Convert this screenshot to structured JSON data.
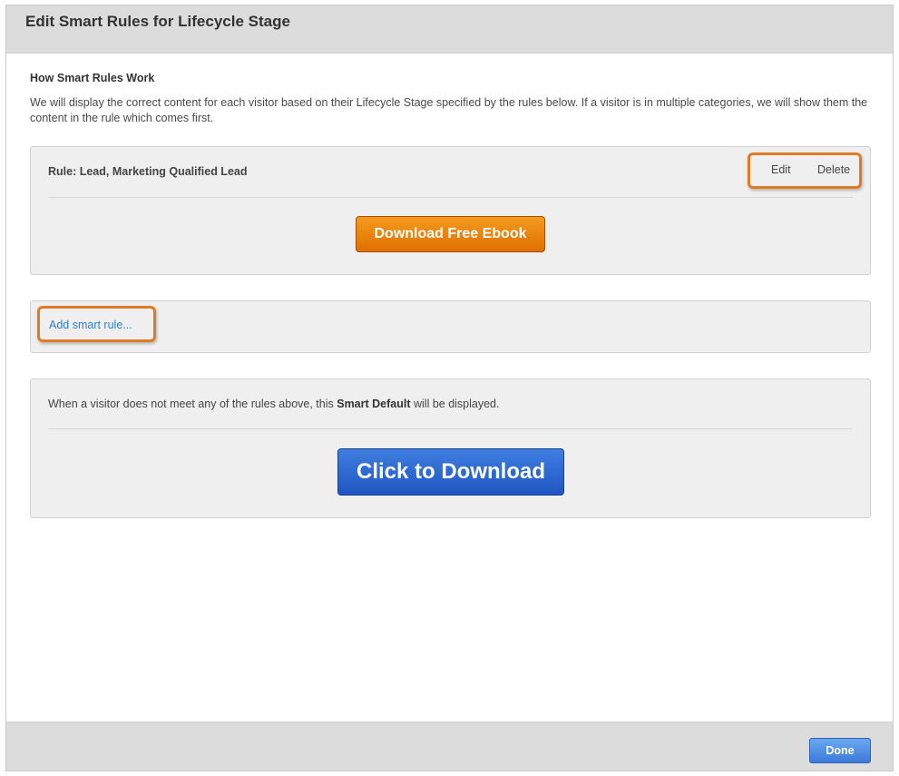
{
  "modal": {
    "title": "Edit Smart Rules for Lifecycle Stage"
  },
  "intro": {
    "heading": "How Smart Rules Work",
    "text": "We will display the correct content for each visitor based on their Lifecycle Stage specified by the rules below. If a visitor is in multiple categories, we will show them the content in the rule which comes first."
  },
  "rule": {
    "label": "Rule: Lead, Marketing Qualified Lead",
    "edit_label": "Edit",
    "delete_label": "Delete",
    "cta_label": "Download Free Ebook"
  },
  "add_rule": {
    "link_label": "Add smart rule..."
  },
  "smart_default": {
    "text_before": "When a visitor does not meet any of the rules above, this ",
    "text_bold": "Smart Default",
    "text_after": " will be displayed.",
    "cta_label": "Click to Download"
  },
  "footer": {
    "done_label": "Done"
  },
  "colors": {
    "highlight": "#e07b24",
    "link": "#2b7fd0",
    "orange_cta": "#e06f00",
    "blue_cta": "#1f55c2",
    "done_button": "#3b7ad9"
  }
}
